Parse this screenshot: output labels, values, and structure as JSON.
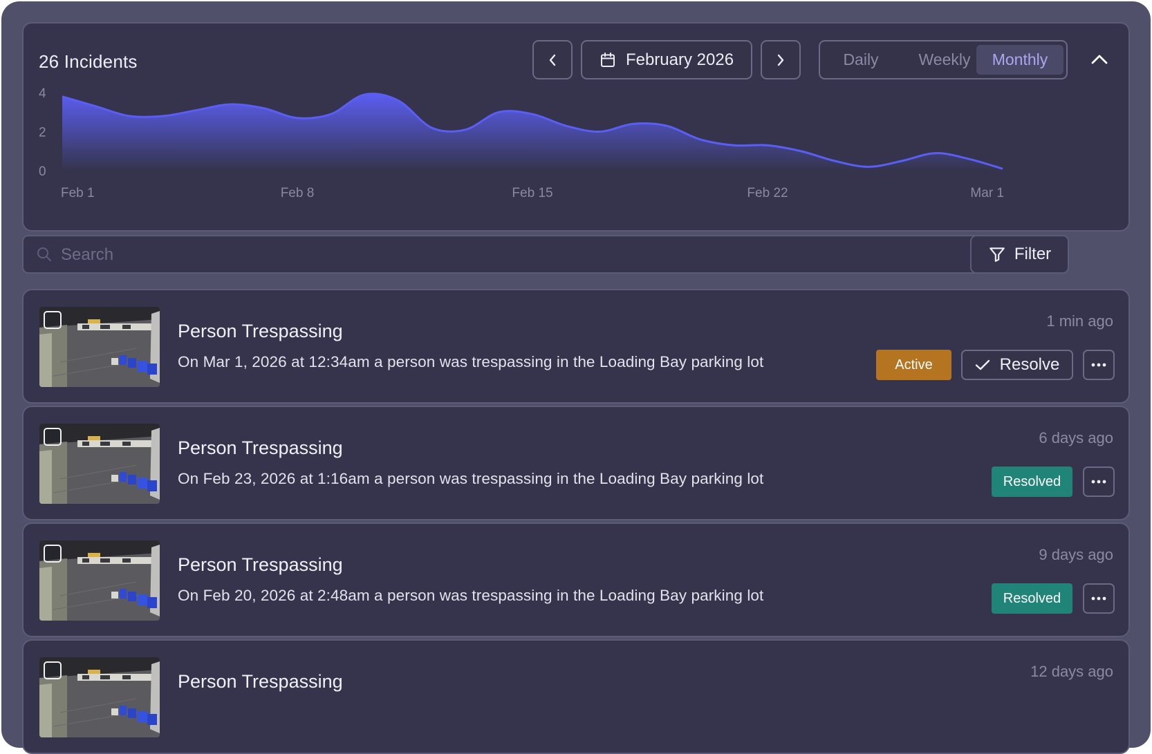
{
  "header": {
    "incident_count_label": "26 Incidents",
    "month_label": "February 2026",
    "view_options": [
      "Daily",
      "Weekly",
      "Monthly"
    ],
    "selected_view": "Monthly"
  },
  "chart_data": {
    "type": "area",
    "ylim": [
      0,
      4
    ],
    "y_ticks": [
      "4",
      "2",
      "0"
    ],
    "x_ticks": [
      "Feb 1",
      "Feb 8",
      "Feb 15",
      "Feb 22",
      "Mar 1"
    ],
    "x": [
      "Feb 1",
      "Feb 2",
      "Feb 3",
      "Feb 4",
      "Feb 5",
      "Feb 6",
      "Feb 7",
      "Feb 8",
      "Feb 9",
      "Feb 10",
      "Feb 11",
      "Feb 12",
      "Feb 13",
      "Feb 14",
      "Feb 15",
      "Feb 16",
      "Feb 17",
      "Feb 18",
      "Feb 19",
      "Feb 20",
      "Feb 21",
      "Feb 22",
      "Feb 23",
      "Feb 24",
      "Feb 25",
      "Feb 26",
      "Feb 27",
      "Feb 28",
      "Mar 1"
    ],
    "values": [
      3.8,
      3.3,
      2.8,
      2.8,
      3.1,
      3.4,
      3.2,
      2.7,
      2.9,
      3.9,
      3.6,
      2.2,
      2.1,
      3.0,
      2.9,
      2.3,
      2.0,
      2.4,
      2.3,
      1.6,
      1.3,
      1.3,
      1.0,
      0.5,
      0.2,
      0.5,
      0.9,
      0.6,
      0.1
    ],
    "grid": false,
    "legend": "none",
    "fill_color": "#5b5ef2",
    "fill_fade_color": "#35344c"
  },
  "search": {
    "placeholder": "Search",
    "value": ""
  },
  "filter": {
    "label": "Filter"
  },
  "incidents": [
    {
      "title": "Person Trespassing",
      "description": "On Mar 1, 2026 at 12:34am a person was trespassing in the Loading Bay parking lot",
      "time": "1 min ago",
      "status": "Active",
      "resolve_label": "Resolve"
    },
    {
      "title": "Person Trespassing",
      "description": "On Feb 23, 2026 at 1:16am a person was trespassing in the Loading Bay parking lot",
      "time": "6 days ago",
      "status": "Resolved"
    },
    {
      "title": "Person Trespassing",
      "description": "On Feb 20, 2026 at 2:48am a person was trespassing in the Loading Bay parking lot",
      "time": "9 days ago",
      "status": "Resolved"
    },
    {
      "title": "Person Trespassing",
      "description": "",
      "time": "12 days ago",
      "status": ""
    }
  ],
  "colors": {
    "active": "#b5741f",
    "resolved": "#218479",
    "accent": "#5b5ef2"
  }
}
